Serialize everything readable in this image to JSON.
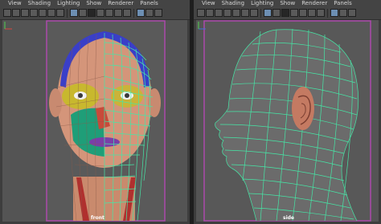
{
  "left_panel": {
    "menu": [
      "View",
      "Shading",
      "Lighting",
      "Show",
      "Renderer",
      "Panels"
    ],
    "camera_label": "front",
    "toolbar_icons": [
      "select-icon",
      "lasso-icon",
      "paint-icon",
      "move-icon",
      "rotate-icon",
      "scale-icon",
      "grid-icon",
      "wireframe-icon",
      "smooth-shade-icon",
      "textured-icon",
      "lights-icon",
      "shadow-icon",
      "xray-icon",
      "isolate-icon",
      "resolution-icon"
    ]
  },
  "right_panel": {
    "menu": [
      "View",
      "Shading",
      "Lighting",
      "Show",
      "Renderer",
      "Panels"
    ],
    "camera_label": "side",
    "toolbar_icons": [
      "select-icon",
      "lasso-icon",
      "paint-icon",
      "move-icon",
      "rotate-icon",
      "scale-icon",
      "grid-icon",
      "wireframe-icon",
      "smooth-shade-icon",
      "textured-icon",
      "lights-icon",
      "shadow-icon",
      "xray-icon",
      "isolate-icon",
      "resolution-icon"
    ]
  },
  "colors": {
    "viewport_bg": "#545454",
    "wireframe": "#46e6a6",
    "selection_frame": "#a64aa6",
    "highlight_icon": "#6d8fb3"
  }
}
